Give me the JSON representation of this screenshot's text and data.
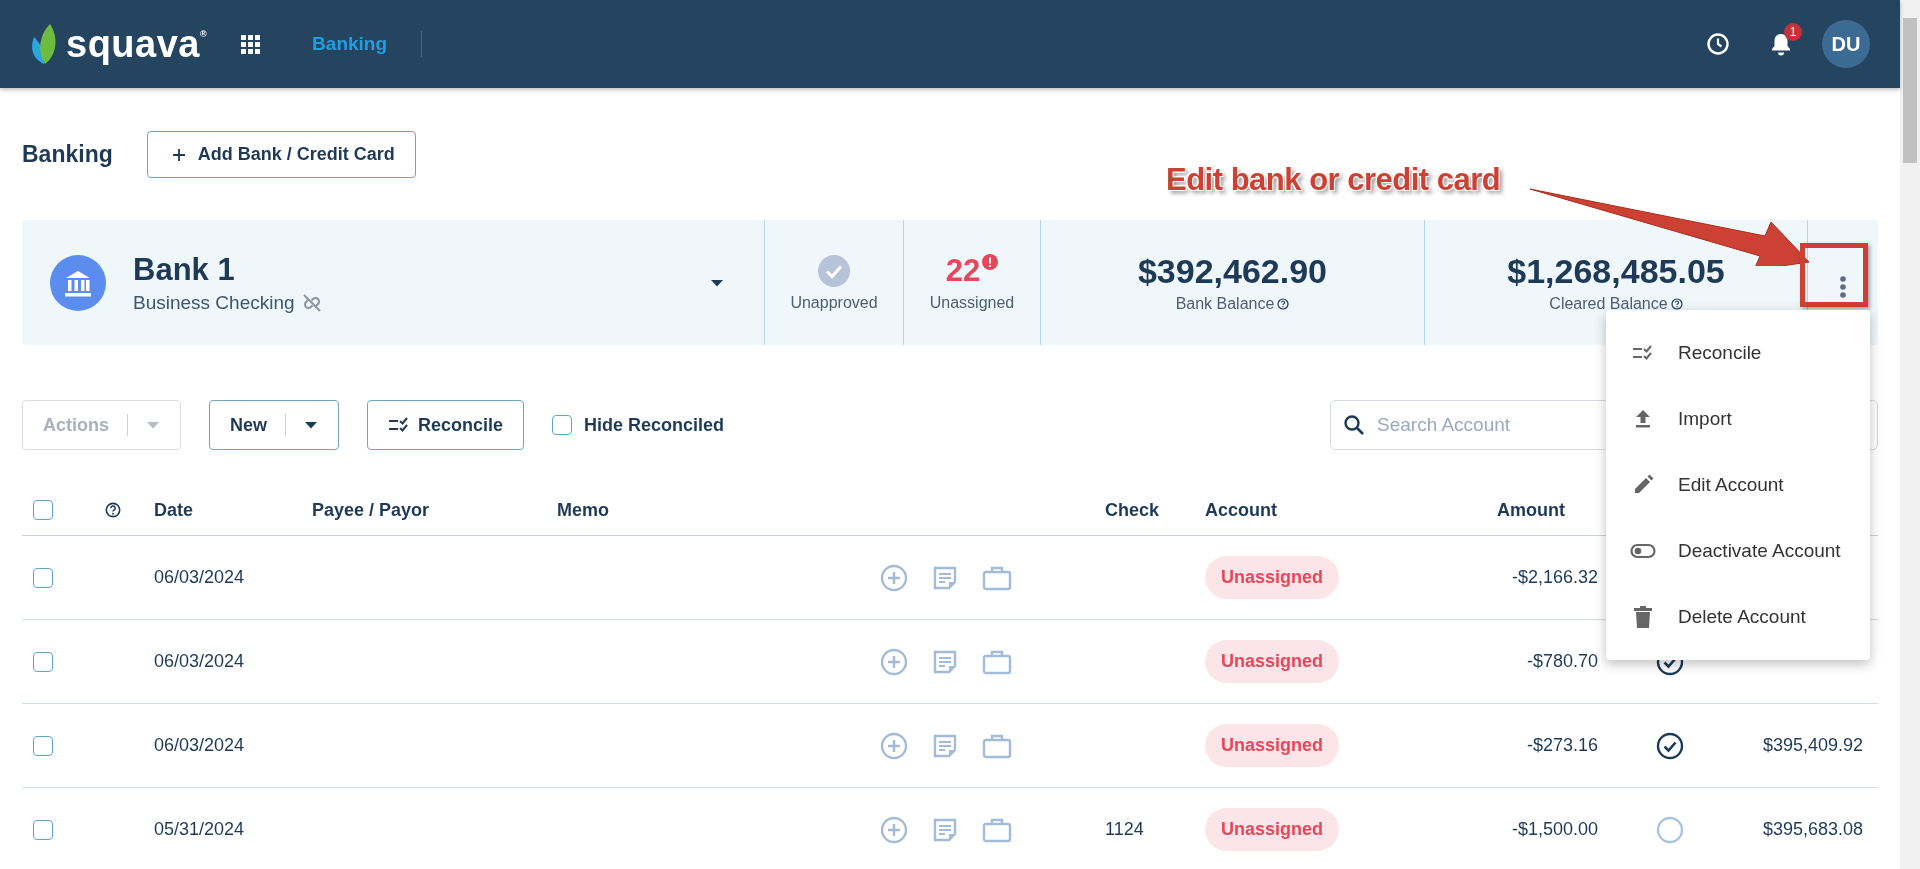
{
  "header": {
    "logo_text": "squava$^{®}$",
    "nav_link": "Banking",
    "notification_count": "1",
    "avatar_initials": "DU"
  },
  "page": {
    "title": "Banking",
    "add_button": "Add Bank / Credit Card"
  },
  "account_card": {
    "name": "Bank 1",
    "type": "Business Checking",
    "unapproved_label": "Unapproved",
    "unassigned_count": "22",
    "unassigned_label": "Unassigned",
    "balances": [
      {
        "amount": "$392,462.90",
        "label": "Bank Balance"
      },
      {
        "amount": "$1,268,485.05",
        "label": "Cleared Balance"
      }
    ]
  },
  "annotation": {
    "text": "Edit bank or credit card"
  },
  "toolbar": {
    "actions": {
      "label": "Actions",
      "disabled": true
    },
    "new_button": "New",
    "reconcile_button": "Reconcile",
    "hide_reconciled": {
      "label": "Hide Reconciled",
      "checked": false
    },
    "search": {
      "placeholder": "Search Account"
    }
  },
  "table": {
    "header_selected": false,
    "columns": [
      "Date",
      "Payee / Payor",
      "Memo",
      "Check",
      "Account",
      "Amount"
    ],
    "rows": [
      {
        "selected": false,
        "date": "06/03/2024",
        "account": "Unassigned",
        "amount": "-$2,166.32"
      },
      {
        "selected": false,
        "date": "06/03/2024",
        "account": "Unassigned",
        "amount": "-$780.70",
        "reconciled": true
      },
      {
        "selected": false,
        "date": "06/03/2024",
        "account": "Unassigned",
        "amount": "-$273.16",
        "reconciled": true,
        "balance": "$395,409.92"
      },
      {
        "selected": false,
        "date": "05/31/2024",
        "check": "1124",
        "account": "Unassigned",
        "amount": "-$1,500.00",
        "reconciled": false,
        "balance": "$395,683.08"
      }
    ]
  },
  "menu": {
    "items": [
      {
        "kind": "reconcile",
        "label": "Reconcile"
      },
      {
        "kind": "import",
        "label": "Import"
      },
      {
        "kind": "edit",
        "label": "Edit Account"
      },
      {
        "kind": "deactivate",
        "label": "Deactivate Account"
      },
      {
        "kind": "delete",
        "label": "Delete Account"
      }
    ]
  }
}
